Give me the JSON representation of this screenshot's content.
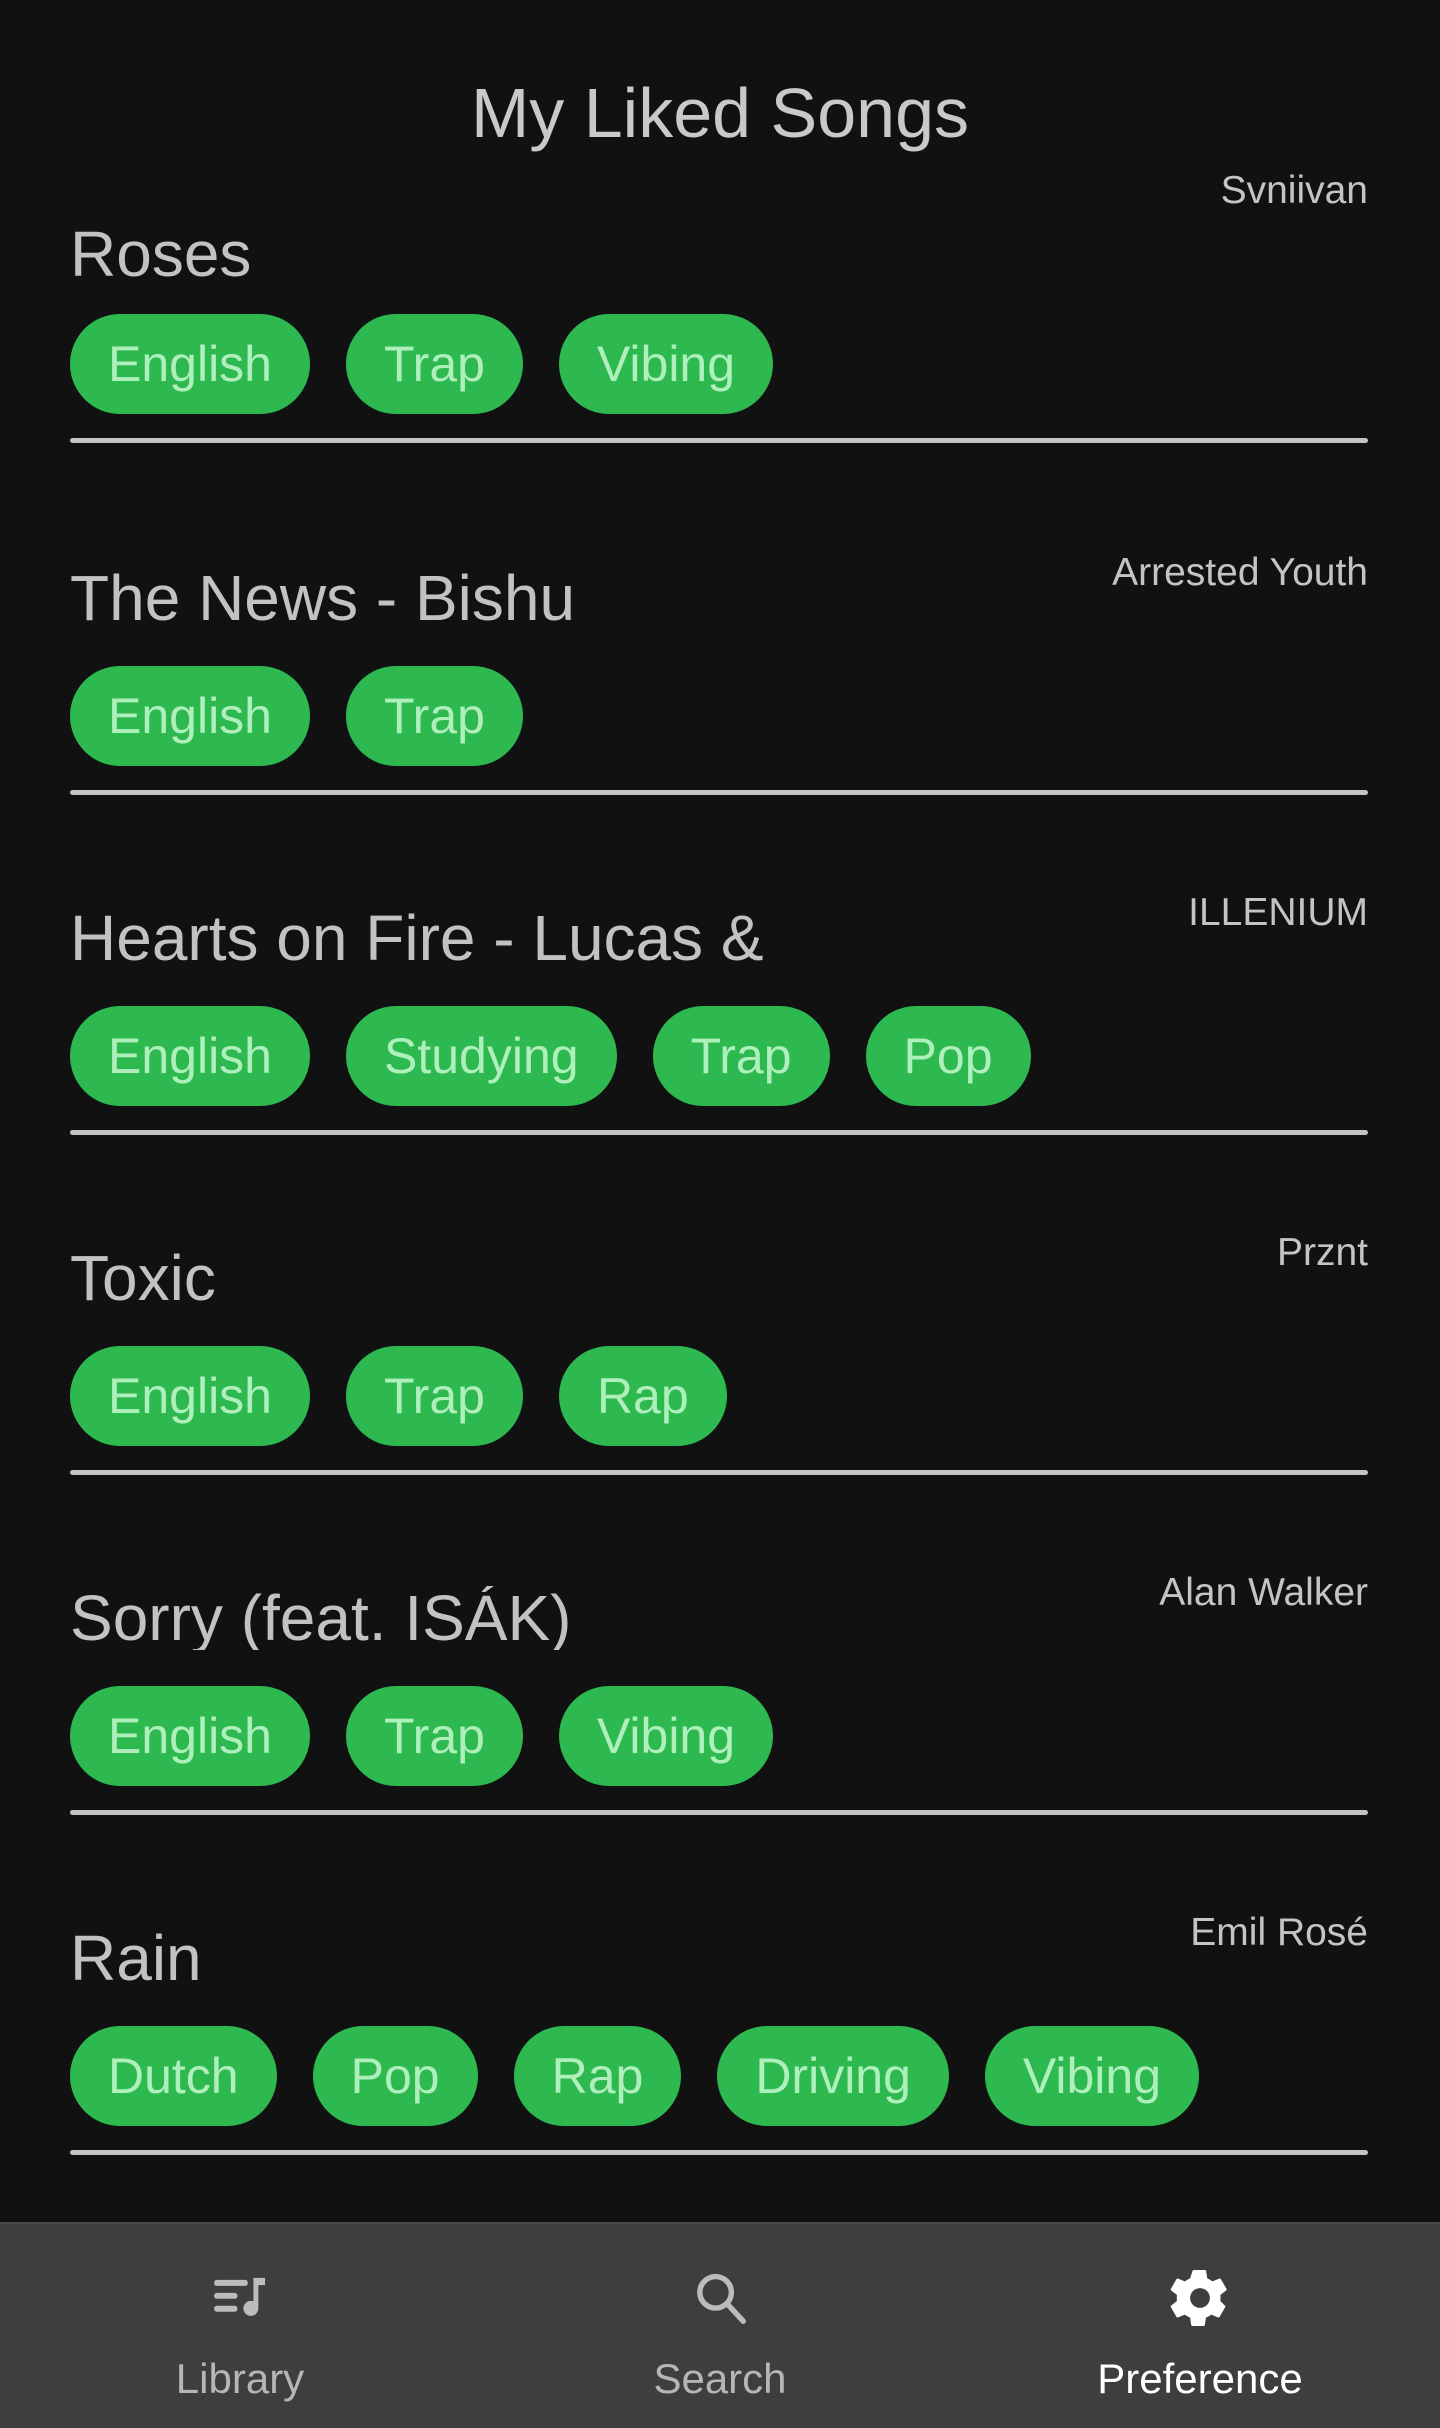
{
  "header": {
    "title": "My Liked Songs"
  },
  "theme": {
    "background": "#111111",
    "title_color": "#c9c9c9",
    "tag_background": "#2db94f",
    "tag_text": "#aeefbc",
    "divider_color": "#c3c3c3",
    "nav_background": "#3e3e3e",
    "nav_label_color": "#b6b6b6",
    "nav_active_color": "#ffffff"
  },
  "songs": [
    {
      "title": "Roses",
      "artist": "Svniivan",
      "tags": [
        "English",
        "Trap",
        "Vibing"
      ]
    },
    {
      "title": "The News - Bishu",
      "artist": "Arrested Youth",
      "tags": [
        "English",
        "Trap"
      ]
    },
    {
      "title": "Hearts on Fire - Lucas &",
      "artist": "ILLENIUM",
      "tags": [
        "English",
        "Studying",
        "Trap",
        "Pop"
      ]
    },
    {
      "title": "Toxic",
      "artist": "Prznt",
      "tags": [
        "English",
        "Trap",
        "Rap"
      ]
    },
    {
      "title": "Sorry (feat. ISÁK)",
      "artist": "Alan Walker",
      "tags": [
        "English",
        "Trap",
        "Vibing"
      ]
    },
    {
      "title": "Rain",
      "artist": "Emil Rosé",
      "tags": [
        "Dutch",
        "Pop",
        "Rap",
        "Driving",
        "Vibing"
      ]
    }
  ],
  "bottom_nav": {
    "items": [
      {
        "label": "Library",
        "icon": "queue-music-icon",
        "active": false
      },
      {
        "label": "Search",
        "icon": "search-icon",
        "active": false
      },
      {
        "label": "Preference",
        "icon": "gear-icon",
        "active": true
      }
    ]
  }
}
